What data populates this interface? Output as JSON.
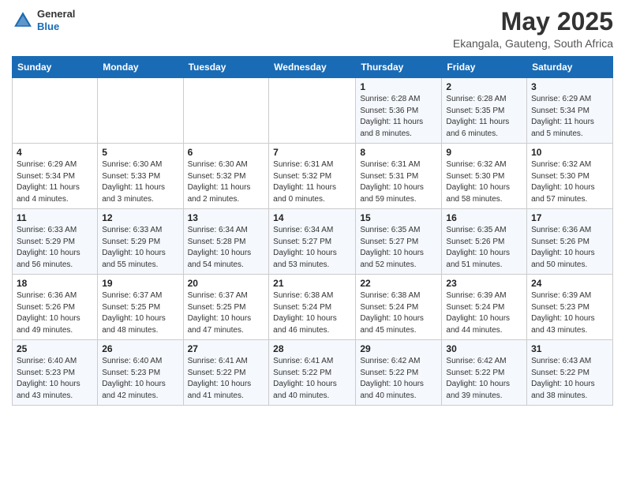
{
  "header": {
    "logo_general": "General",
    "logo_blue": "Blue",
    "month_title": "May 2025",
    "location": "Ekangala, Gauteng, South Africa"
  },
  "days_of_week": [
    "Sunday",
    "Monday",
    "Tuesday",
    "Wednesday",
    "Thursday",
    "Friday",
    "Saturday"
  ],
  "weeks": [
    [
      {
        "day": "",
        "info": ""
      },
      {
        "day": "",
        "info": ""
      },
      {
        "day": "",
        "info": ""
      },
      {
        "day": "",
        "info": ""
      },
      {
        "day": "1",
        "info": "Sunrise: 6:28 AM\nSunset: 5:36 PM\nDaylight: 11 hours\nand 8 minutes."
      },
      {
        "day": "2",
        "info": "Sunrise: 6:28 AM\nSunset: 5:35 PM\nDaylight: 11 hours\nand 6 minutes."
      },
      {
        "day": "3",
        "info": "Sunrise: 6:29 AM\nSunset: 5:34 PM\nDaylight: 11 hours\nand 5 minutes."
      }
    ],
    [
      {
        "day": "4",
        "info": "Sunrise: 6:29 AM\nSunset: 5:34 PM\nDaylight: 11 hours\nand 4 minutes."
      },
      {
        "day": "5",
        "info": "Sunrise: 6:30 AM\nSunset: 5:33 PM\nDaylight: 11 hours\nand 3 minutes."
      },
      {
        "day": "6",
        "info": "Sunrise: 6:30 AM\nSunset: 5:32 PM\nDaylight: 11 hours\nand 2 minutes."
      },
      {
        "day": "7",
        "info": "Sunrise: 6:31 AM\nSunset: 5:32 PM\nDaylight: 11 hours\nand 0 minutes."
      },
      {
        "day": "8",
        "info": "Sunrise: 6:31 AM\nSunset: 5:31 PM\nDaylight: 10 hours\nand 59 minutes."
      },
      {
        "day": "9",
        "info": "Sunrise: 6:32 AM\nSunset: 5:30 PM\nDaylight: 10 hours\nand 58 minutes."
      },
      {
        "day": "10",
        "info": "Sunrise: 6:32 AM\nSunset: 5:30 PM\nDaylight: 10 hours\nand 57 minutes."
      }
    ],
    [
      {
        "day": "11",
        "info": "Sunrise: 6:33 AM\nSunset: 5:29 PM\nDaylight: 10 hours\nand 56 minutes."
      },
      {
        "day": "12",
        "info": "Sunrise: 6:33 AM\nSunset: 5:29 PM\nDaylight: 10 hours\nand 55 minutes."
      },
      {
        "day": "13",
        "info": "Sunrise: 6:34 AM\nSunset: 5:28 PM\nDaylight: 10 hours\nand 54 minutes."
      },
      {
        "day": "14",
        "info": "Sunrise: 6:34 AM\nSunset: 5:27 PM\nDaylight: 10 hours\nand 53 minutes."
      },
      {
        "day": "15",
        "info": "Sunrise: 6:35 AM\nSunset: 5:27 PM\nDaylight: 10 hours\nand 52 minutes."
      },
      {
        "day": "16",
        "info": "Sunrise: 6:35 AM\nSunset: 5:26 PM\nDaylight: 10 hours\nand 51 minutes."
      },
      {
        "day": "17",
        "info": "Sunrise: 6:36 AM\nSunset: 5:26 PM\nDaylight: 10 hours\nand 50 minutes."
      }
    ],
    [
      {
        "day": "18",
        "info": "Sunrise: 6:36 AM\nSunset: 5:26 PM\nDaylight: 10 hours\nand 49 minutes."
      },
      {
        "day": "19",
        "info": "Sunrise: 6:37 AM\nSunset: 5:25 PM\nDaylight: 10 hours\nand 48 minutes."
      },
      {
        "day": "20",
        "info": "Sunrise: 6:37 AM\nSunset: 5:25 PM\nDaylight: 10 hours\nand 47 minutes."
      },
      {
        "day": "21",
        "info": "Sunrise: 6:38 AM\nSunset: 5:24 PM\nDaylight: 10 hours\nand 46 minutes."
      },
      {
        "day": "22",
        "info": "Sunrise: 6:38 AM\nSunset: 5:24 PM\nDaylight: 10 hours\nand 45 minutes."
      },
      {
        "day": "23",
        "info": "Sunrise: 6:39 AM\nSunset: 5:24 PM\nDaylight: 10 hours\nand 44 minutes."
      },
      {
        "day": "24",
        "info": "Sunrise: 6:39 AM\nSunset: 5:23 PM\nDaylight: 10 hours\nand 43 minutes."
      }
    ],
    [
      {
        "day": "25",
        "info": "Sunrise: 6:40 AM\nSunset: 5:23 PM\nDaylight: 10 hours\nand 43 minutes."
      },
      {
        "day": "26",
        "info": "Sunrise: 6:40 AM\nSunset: 5:23 PM\nDaylight: 10 hours\nand 42 minutes."
      },
      {
        "day": "27",
        "info": "Sunrise: 6:41 AM\nSunset: 5:22 PM\nDaylight: 10 hours\nand 41 minutes."
      },
      {
        "day": "28",
        "info": "Sunrise: 6:41 AM\nSunset: 5:22 PM\nDaylight: 10 hours\nand 40 minutes."
      },
      {
        "day": "29",
        "info": "Sunrise: 6:42 AM\nSunset: 5:22 PM\nDaylight: 10 hours\nand 40 minutes."
      },
      {
        "day": "30",
        "info": "Sunrise: 6:42 AM\nSunset: 5:22 PM\nDaylight: 10 hours\nand 39 minutes."
      },
      {
        "day": "31",
        "info": "Sunrise: 6:43 AM\nSunset: 5:22 PM\nDaylight: 10 hours\nand 38 minutes."
      }
    ]
  ]
}
